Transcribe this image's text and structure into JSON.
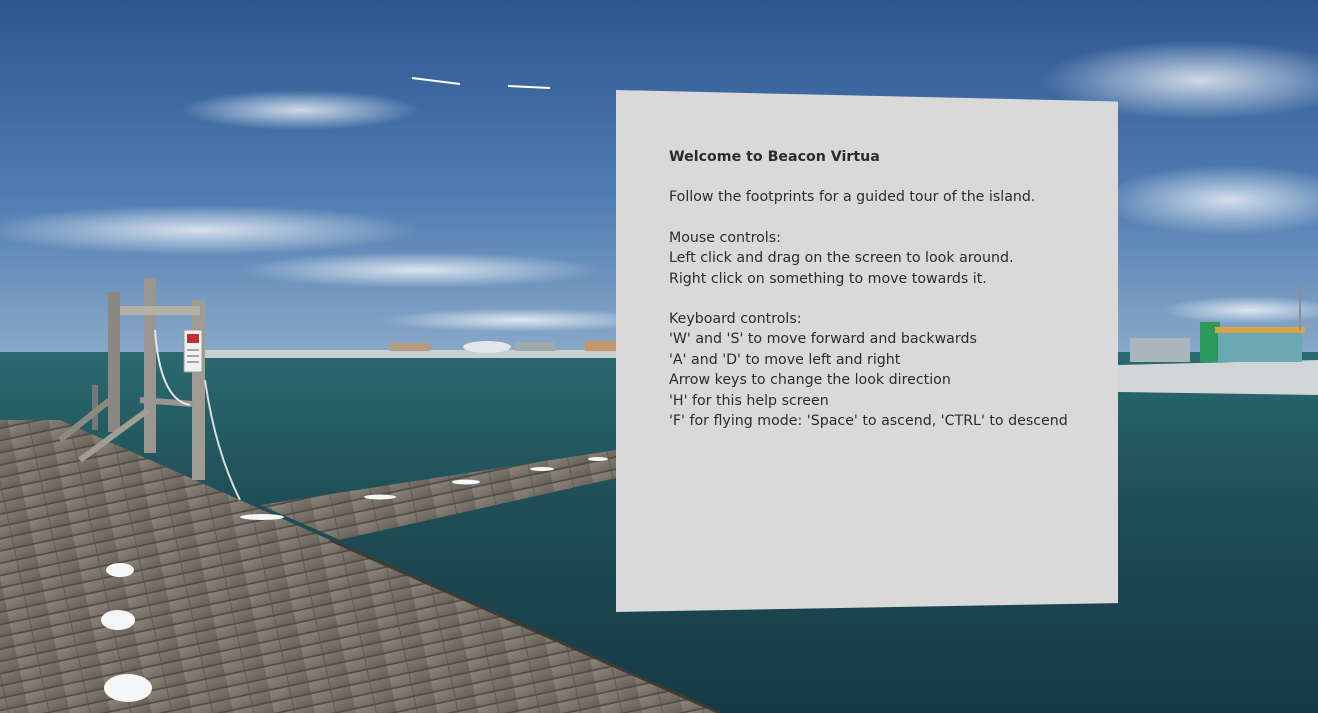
{
  "help_panel": {
    "title": "Welcome to Beacon Virtua",
    "intro": "Follow the footprints for a guided tour of the island.",
    "mouse": {
      "heading": "Mouse controls:",
      "lines": [
        "Left click and drag on the screen to look around.",
        "Right click on something to move towards it."
      ]
    },
    "keyboard": {
      "heading": "Keyboard controls:",
      "lines": [
        "'W' and 'S' to move forward and backwards",
        "'A' and 'D' to move left and right",
        "Arrow keys to change the look direction",
        "'H' for this help screen",
        "'F' for flying mode: 'Space' to ascend, 'CTRL' to descend"
      ]
    }
  },
  "scene": {
    "sky_color": "#2f5d97",
    "water_color": "#1f4f58",
    "dock_color": "#7d776f",
    "footprint_color": "#f4f6f7",
    "panel_color": "#d9d9d9"
  }
}
